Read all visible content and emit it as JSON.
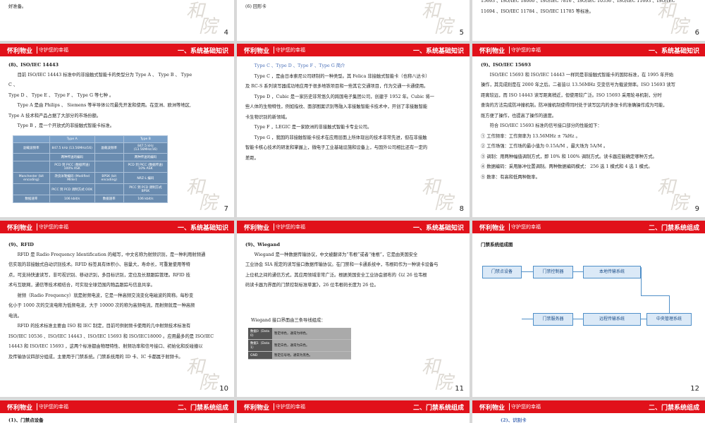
{
  "header": {
    "logo": "怀利物业",
    "slogan": "守护您的幸福"
  },
  "watermark": [
    "和",
    "院"
  ],
  "pages": {
    "p4": {
      "num": "4",
      "text": "好准备。"
    },
    "p5": {
      "num": "5",
      "text": "(6) 回形卡"
    },
    "p6": {
      "num": "6",
      "lines": [
        "15693 、ISO/IEC 18000 、ISO/IEC 7816 、ISO/IEC 10536 、ISO/IEC 11693 、ISO/IEC",
        "11694 、ISO/IEC 11784 、ISO/IEC 11785 等标准。"
      ]
    },
    "p7": {
      "num": "7",
      "section": "一、系统基础知识",
      "heading": "(8)、ISO/IEC 14443",
      "lines": [
        "目前 ISO/IEC 14443 标准中的非接触式智能卡的类型分为 Type A 、 Type B 、 Type",
        "C 、",
        "Type D 、 Type E 、 Type F 、 Type G 等七种 。",
        "Type A 是由 Philips 、 Siemens 等半导体公司最先开发和使用。在亚洲、欧洲等地区,",
        "Type A 技术和产品占据了大部分的市场份额。",
        "Type B ，是一个开放式的非接触式智能卡标准。"
      ],
      "table": {
        "headers": [
          "",
          "Type A",
          "",
          "Type B"
        ],
        "rows": [
          [
            "副载波频率",
            "847.5 kHz (13.56MHz/16)",
            "副载波频率",
            "847.5 kHz (13.56MHz/16)"
          ],
          [
            "",
            "两种传送的编码",
            "",
            "两种传送的编码"
          ],
          [
            "",
            "PCD 到 PICC (数据传送) 100% ASK",
            "",
            "PCD 到 PICC (数据传送) 10% ASK"
          ],
          [
            "Manchester (bit encoding)",
            "改良米勒编码 (Modified Miller)",
            "BPSK (bit encoding)",
            "NRZ-L 编码"
          ],
          [
            "",
            "PICC 到 PCD 调制方式 OOK",
            "",
            "PICC 到 PCD 调制方式 BPSK"
          ],
          [
            "数据速率",
            "106 kbit/s",
            "数据速率",
            "106 kbit/s"
          ]
        ]
      }
    },
    "p8": {
      "num": "8",
      "section": "一、系统基础知识",
      "heading": "Type C 、Type D 、Type F 、Type G 简介",
      "lines": [
        "Type C ，是由日本索尼公司研制的一种类型。其 Felica 非接触式智能卡（也称八达卡）",
        "及 RC-S 系列读写器成功地应用于很多地铁项目和一些其它交通项目，作为交通一卡通使用。",
        "Type D ，Cubic 是一家历史非常悠久的跨国电子集团公司，创建于 1952 年。Cubic 将一",
        "些人体的生物特性，例如指纹、面部图案识别等融入非接触智能卡技术中，开创了非接触智能",
        "卡生物识别的新领域。",
        "Type F ，LEGIC 是一家欧洲的非接触式智能卡专业公司。",
        "Type G ，我国的非接触智能卡技术在应用层面上所体现出的技术非常先进，但在非接触",
        "智能卡核心技术的研发和掌握上，微电子工业基础设施和设备上，与国外公司相比还有一定的",
        "差距。"
      ]
    },
    "p9": {
      "num": "9",
      "section": "一、系统基础知识",
      "heading": "(9)、ISO/IEC 15693",
      "lines": [
        "ISO/IEC 15693 和 ISO/IEC 14443 一样同是非接触式智能卡的国际标准，在 1995 年开始",
        "操作，其完成则是在 2000 年之后。二者皆以 13.56MHz 交变信号为载波频率。ISO 15693 读写",
        "距离较远，而 ISO 14443 读写距离稍近，但使用较广泛。ISO 15693 采用轮寻机制，分时",
        "查询的方法完成防冲撞机制。防冲撞机制使得同时处于读写区内的多张卡的准确操作成为可能，",
        "既方便了操作，也提高了操作的速度。",
        "符合 ISO/IEC 15693 标准的信号接口部分的性能如下："
      ],
      "list": [
        "① 工作频率：工作频率为 13.56MHz ± 7kHz 。",
        "② 工作场强：工作场的最小值为 0.15A/M ，最大场为 5A/M 。",
        "③ 调制：用两种幅值调制方式，即 10% 和 100% 调制方式。读卡器应能确定哪种方式。",
        "④ 数据编码：采用脉冲位置调制。两种数据编码模式： 256 选 1 模式和 4 选 1 模式。",
        "⑤ 数率：有高和低两种数率。"
      ]
    },
    "p10": {
      "num": "10",
      "section": "一、系统基础知识",
      "heading": "(9)、RFID",
      "lines": [
        "RFID 是 Radio Frequency Identification 的缩写，中文名称为射频识别，是一种利用射频通",
        "信实现的非接触式自动识别技术。RFID 标签具有体积小、容量大，寿命长，可重复使用等特",
        "点，可支持快速读写，非可视识别、移动识别，多目标识别，定位及长期跟踪管理。RFID 技",
        "术与互联网，通信等技术相结合，可实现全球范围内物品跟踪与信息共享。",
        "射频（Radio Frequency）就是射频电波，它是一种高频交流变化电磁波的简称。每秒变",
        "化小于 1000 次的交流电称为低频电流，大于 10000 次的称为高频电流，而射频就是一种高频",
        "电流。",
        "RFID 的技术标准主要由 ISO 和 IEC 制定，目前可供射频卡使用的几中射频技术标准有",
        "ISO/IEC 10536 、ISO/IEC 14443 、ISO/IEC 15693 和 ISO/IEC18000 。应用最多的是 ISO/IEC",
        "14443 和 ISO/IEC 15693 ，这两个标准都由物理特性、射频功率和信号接口、初始化和反碰撞以",
        "及传输协议四部分组成，主要用于门禁系统。门禁系统用的 ID 卡、IC 卡都属于射频卡。"
      ]
    },
    "p11": {
      "num": "11",
      "section": "一、系统基础知识",
      "heading": "(9)、Wiegand",
      "lines": [
        "Wiegand 是一种数据传输协议，中文被翻译为“韦根”或者“维根”，它是由美国安全",
        "工业协会 SIA 规定的读写接口数据传输协议。在门禁和一卡通系统中，韦根码作为一种读卡设备与",
        "上位机之间的通信方式，其应用领域非常广泛。根据美国安全工业协会颁布的《以 26 位韦根",
        "码读卡器为界面的门禁控制标准草案》，26 位韦根码长度为 26 位。"
      ],
      "wiegand_title": "Wiegand 接口界面由三条导线组成：",
      "wiegand_rows": [
        [
          "数据0（Data 0）",
          "暂定绿色，通常为绿色。"
        ],
        [
          "数据1（Data 1）",
          "暂定白色，通常为白色。"
        ],
        [
          "GND",
          "暂定信号地，通常为黑色。"
        ]
      ]
    },
    "p12": {
      "num": "12",
      "section": "二、门禁系统组成",
      "heading": "门禁系统组成图",
      "boxes": [
        "门禁点设备",
        "门禁控制器",
        "本地传输系统",
        "门禁服务器",
        "远程传输系统",
        "中央管理系统"
      ]
    },
    "p13": {
      "section": "二、门禁系统组成",
      "heading": "(1)、门禁点设备"
    },
    "p14": {
      "section": "二、门禁系统组成"
    },
    "p15": {
      "section": "二、门禁系统组成",
      "heading": "(2)、识别卡"
    }
  }
}
